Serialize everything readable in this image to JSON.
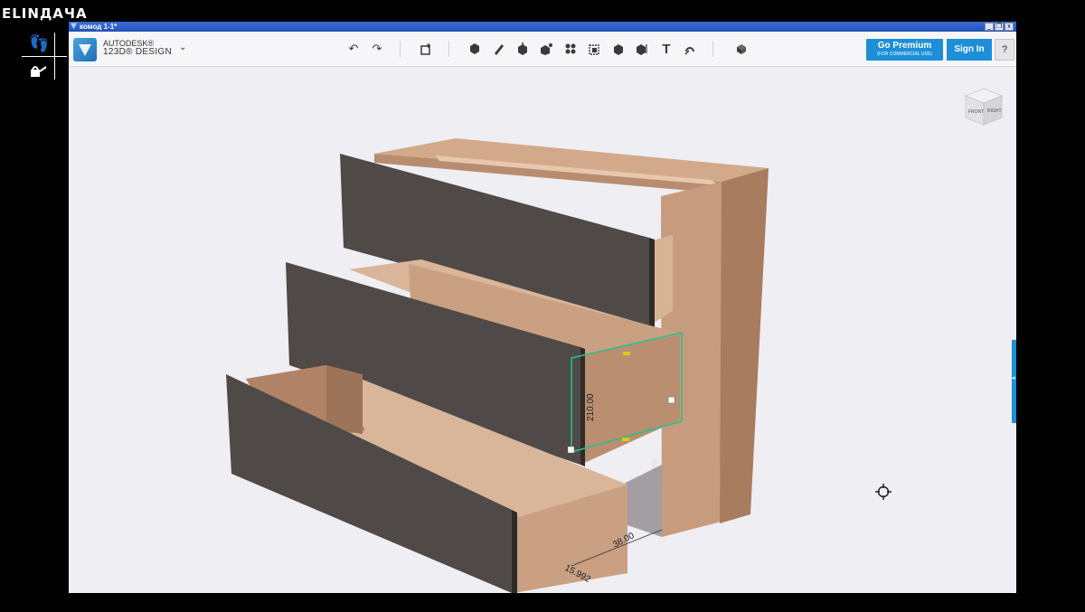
{
  "overlay": {
    "brand": "ELINДАЧА",
    "icons": [
      "slippers-icon",
      "watering-can-icon"
    ]
  },
  "window": {
    "title": "комод 1-1*",
    "controls": [
      "_",
      "❐",
      "x"
    ]
  },
  "app": {
    "brand_line1": "AUTODESK®",
    "brand_line2": "123D® DESIGN"
  },
  "toolbar": {
    "tools": [
      "undo-icon",
      "redo-icon",
      "import-icon",
      "primitives-icon",
      "sketch-icon",
      "construct-icon",
      "modify-icon",
      "pattern-icon",
      "grouping-icon",
      "combine-icon",
      "measure-icon",
      "text-icon",
      "snap-icon",
      "material-icon"
    ],
    "text_tool_glyph": "T"
  },
  "account": {
    "premium_label": "Go Premium",
    "premium_sublabel": "(FOR COMMERCIAL USE)",
    "signin_label": "Sign In",
    "help_label": "?"
  },
  "viewcube": {
    "front": "FRONT",
    "right": "RIGHT"
  },
  "dimensions": {
    "height": "210.00",
    "width": "38.00",
    "depth": "15.992"
  },
  "colors": {
    "accent": "#1d8fd8",
    "drawer_front": "#4f4a47",
    "wood": "#caa083",
    "selection": "#27c08a"
  }
}
